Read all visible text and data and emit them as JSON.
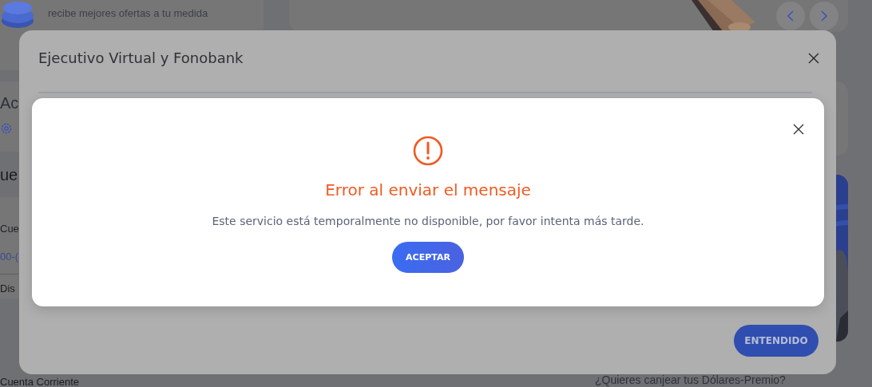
{
  "background": {
    "promo_text": "recibe mejores ofertas a tu medida",
    "section_1_title": "Ac",
    "section_2_title": "ue",
    "account_card": {
      "name": "Cue",
      "number": "00-(",
      "balance_label": "Dis"
    },
    "account_type": "Cuenta Corriente",
    "promo_question": "¿Quieres canjear tus Dólares-Premio?"
  },
  "modal": {
    "title": "Ejecutivo Virtual y Fonobank",
    "button": "ENTENDIDO"
  },
  "error_dialog": {
    "title": "Error al enviar el mensaje",
    "message": "Este servicio está temporalmente no disponible, por favor intenta más tarde.",
    "button": "ACEPTAR"
  }
}
